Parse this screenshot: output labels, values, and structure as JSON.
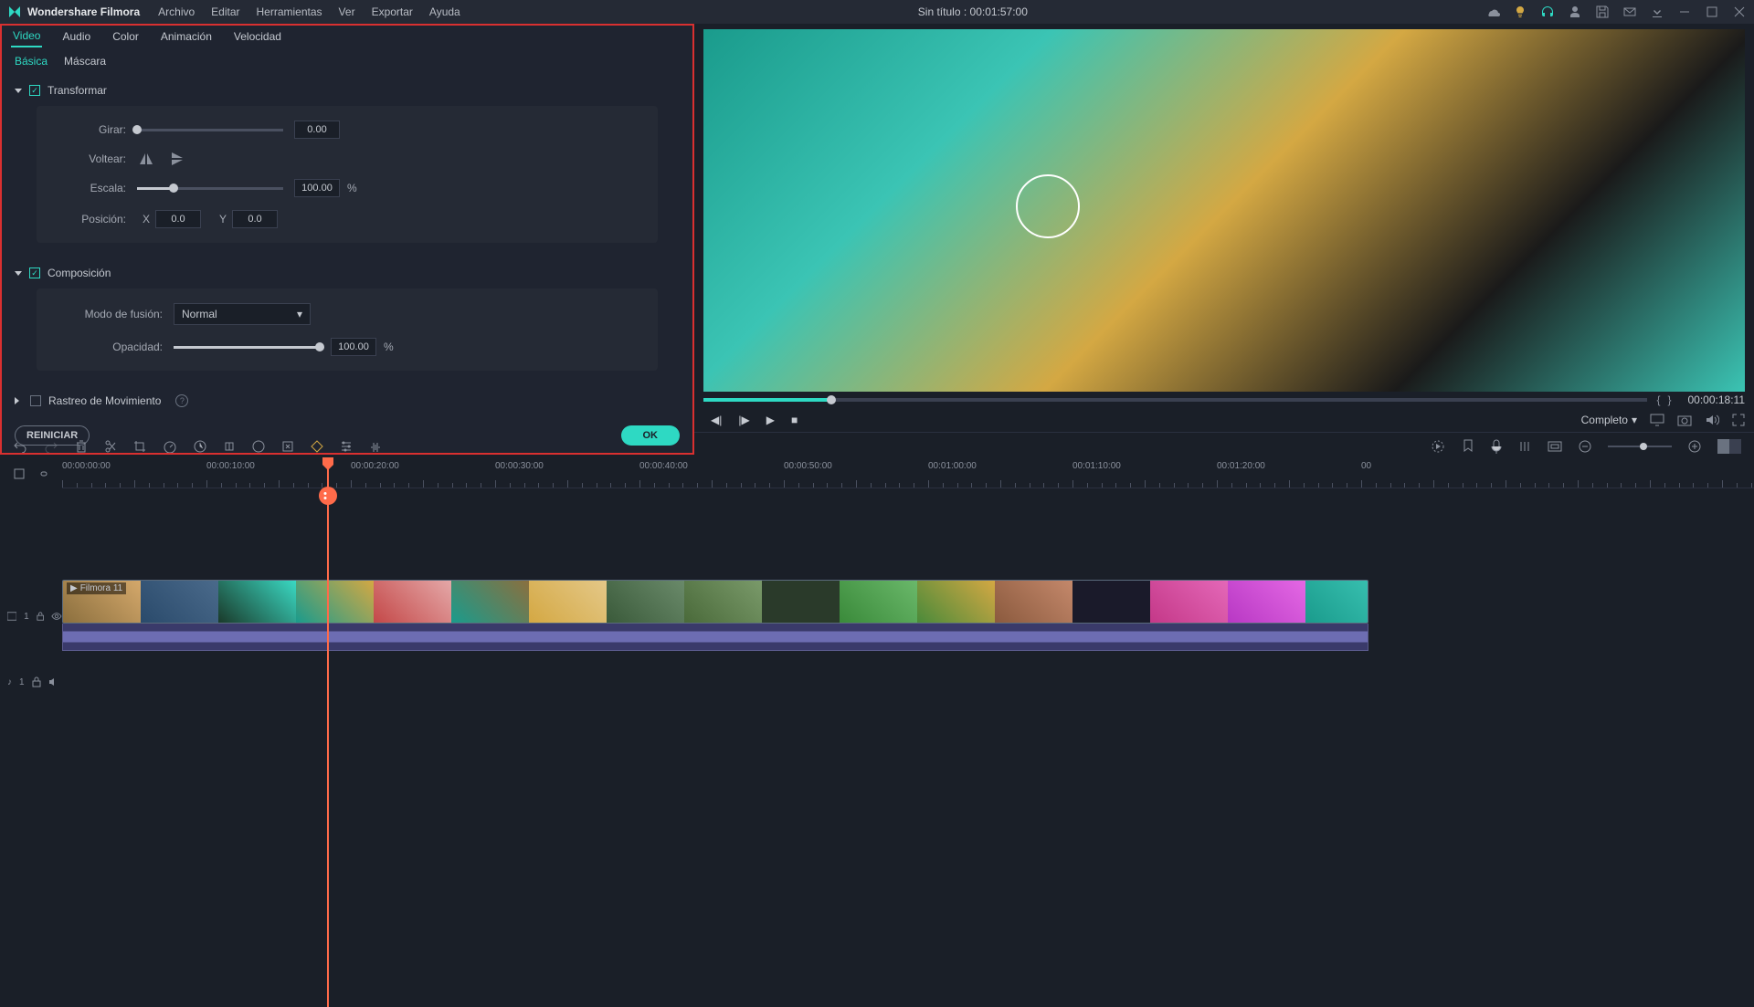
{
  "app": {
    "name": "Wondershare Filmora"
  },
  "menu": {
    "file": "Archivo",
    "edit": "Editar",
    "tools": "Herramientas",
    "view": "Ver",
    "export": "Exportar",
    "help": "Ayuda"
  },
  "title": {
    "project": "Sin título",
    "duration": "00:01:57:00"
  },
  "prop_tabs": {
    "video": "Video",
    "audio": "Audio",
    "color": "Color",
    "animation": "Animación",
    "speed": "Velocidad"
  },
  "sub_tabs": {
    "basic": "Básica",
    "mask": "Máscara"
  },
  "transform": {
    "title": "Transformar",
    "rotate_label": "Girar:",
    "rotate_value": "0.00",
    "flip_label": "Voltear:",
    "scale_label": "Escala:",
    "scale_value": "100.00",
    "scale_unit": "%",
    "position_label": "Posición:",
    "pos_x_label": "X",
    "pos_x_value": "0.0",
    "pos_y_label": "Y",
    "pos_y_value": "0.0"
  },
  "composition": {
    "title": "Composición",
    "blend_label": "Modo de fusión:",
    "blend_value": "Normal",
    "opacity_label": "Opacidad:",
    "opacity_value": "100.00",
    "opacity_unit": "%"
  },
  "motion": {
    "title": "Rastreo de Movimiento"
  },
  "buttons": {
    "reset": "REINICIAR",
    "ok": "OK"
  },
  "preview": {
    "timecode": "00:00:18:11",
    "quality": "Completo"
  },
  "timeline": {
    "labels": [
      "00:00:00:00",
      "00:00:10:00",
      "00:00:20:00",
      "00:00:30:00",
      "00:00:40:00",
      "00:00:50:00",
      "00:01:00:00",
      "00:01:10:00",
      "00:01:20:00",
      "00"
    ],
    "track_video": "1",
    "track_audio": "1",
    "clip_name": "Filmora 11"
  },
  "colors": {
    "accent": "#2ed9c3",
    "accent2": "#ff6b4a",
    "highlight": "#d93030"
  }
}
